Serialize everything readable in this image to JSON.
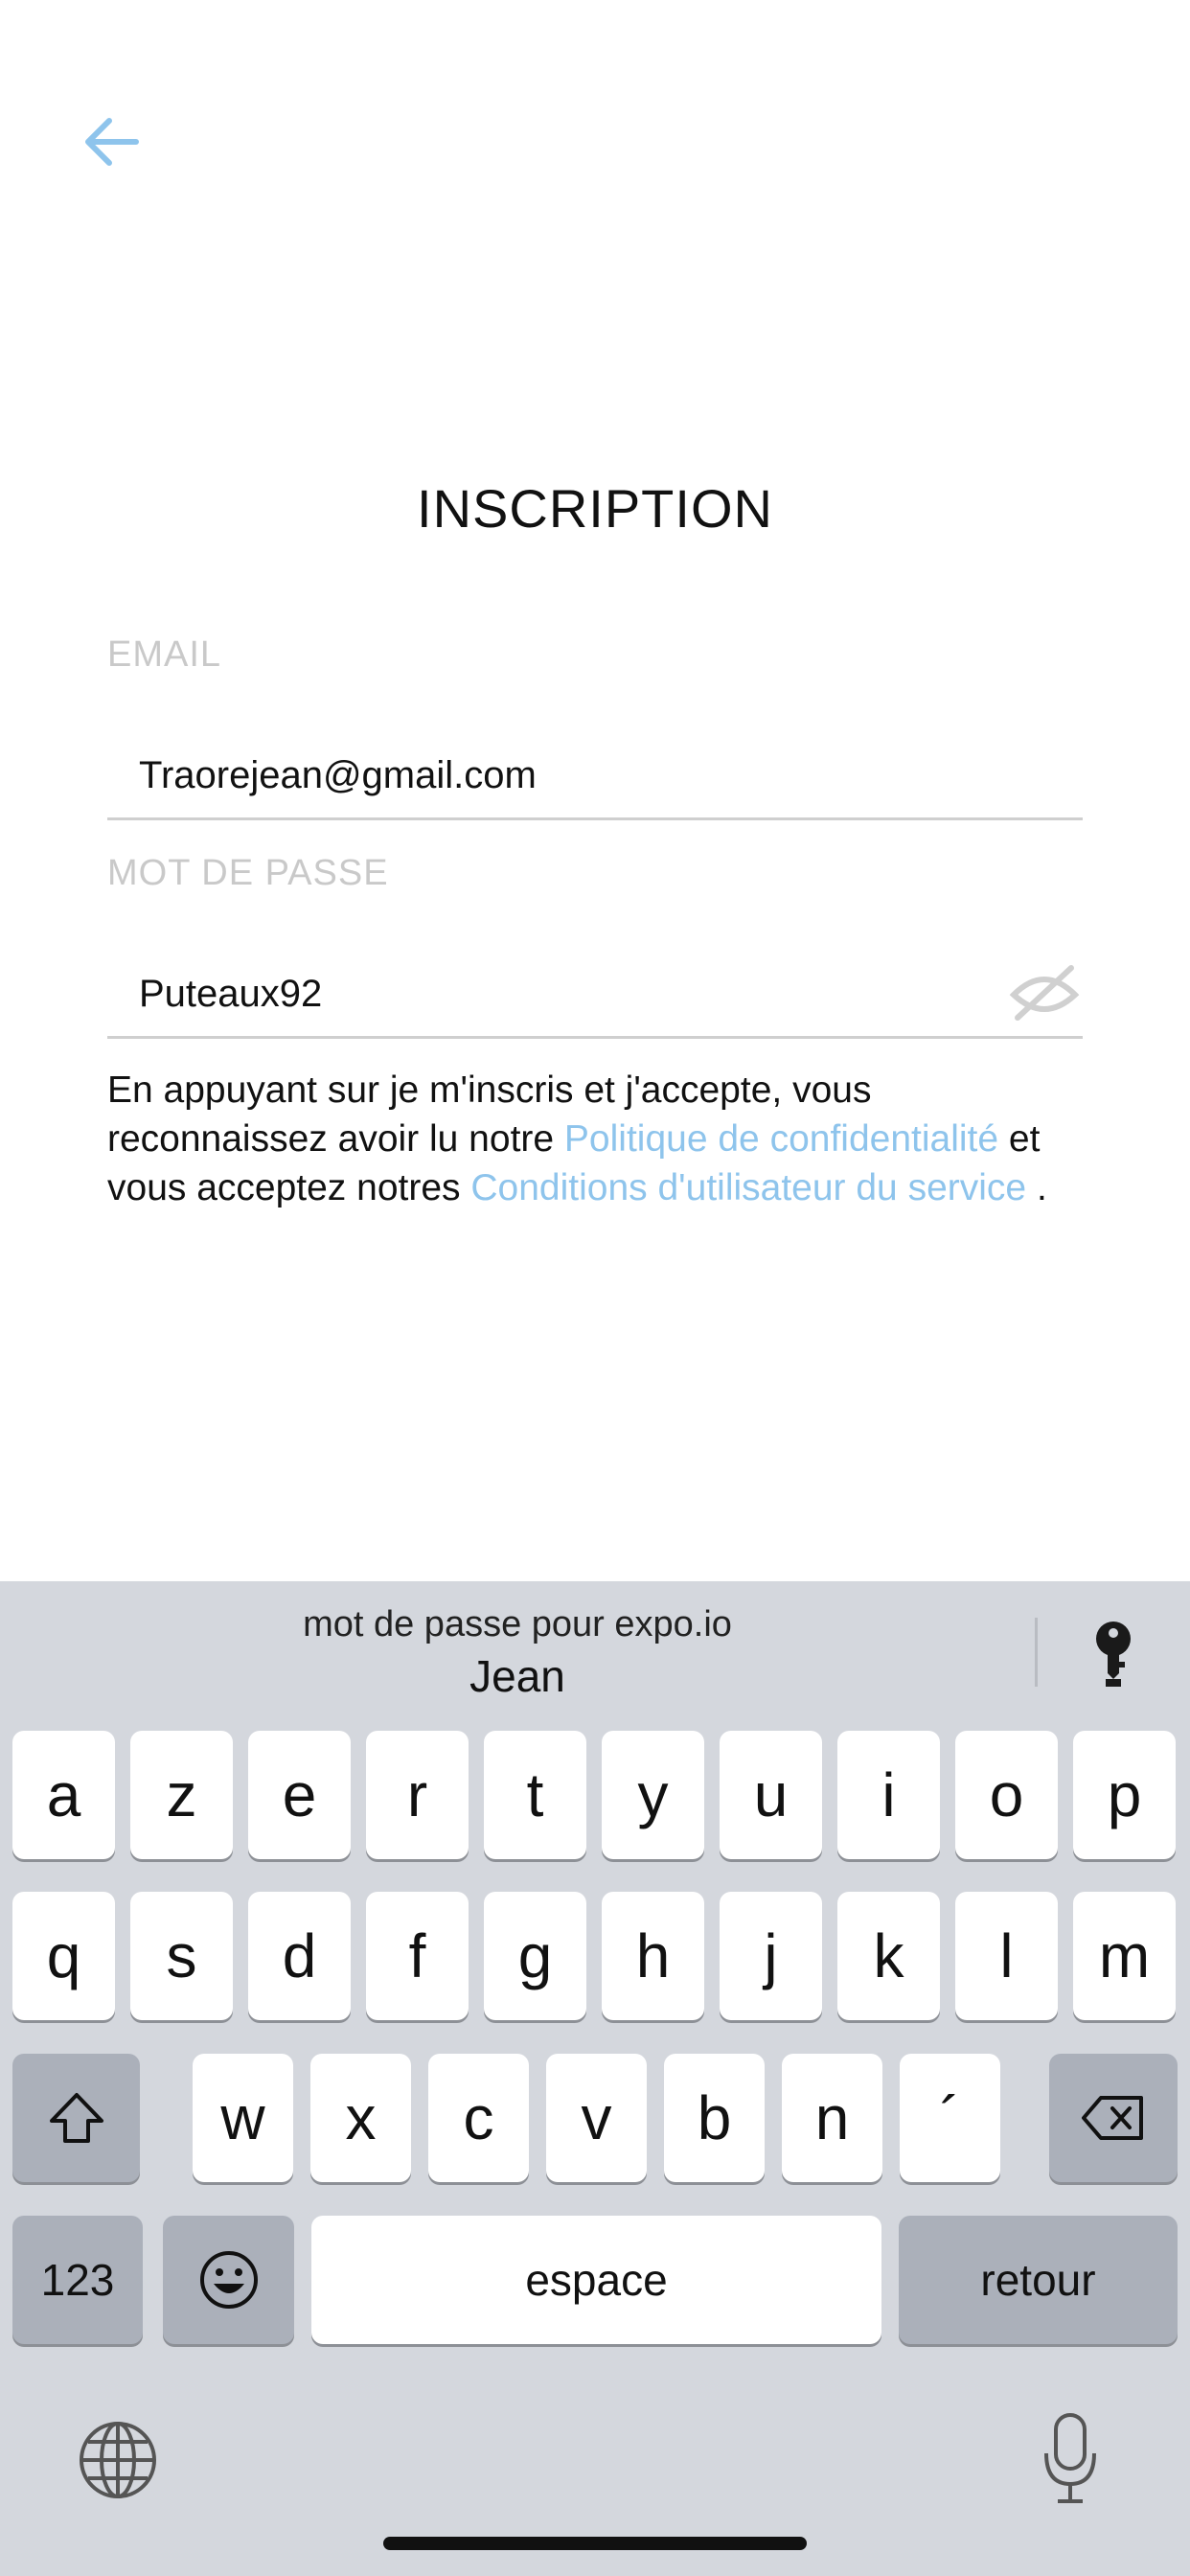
{
  "header": {
    "title": "INSCRIPTION"
  },
  "form": {
    "email_label": "EMAIL",
    "email_value": "Traorejean@gmail.com",
    "password_label": "MOT DE PASSE",
    "password_value": "Puteaux92"
  },
  "consent": {
    "text_1": "En appuyant sur je m'inscris et j'accepte, vous reconnaissez avoir lu notre ",
    "link_privacy": "Politique de confidentialité",
    "text_2": " et vous acceptez notres ",
    "link_terms": "Conditions d'utilisateur du service",
    "text_3": " ."
  },
  "keyboard": {
    "suggestion_caption": "mot de passe pour expo.io",
    "suggestion_value": "Jean",
    "row1": [
      "a",
      "z",
      "e",
      "r",
      "t",
      "y",
      "u",
      "i",
      "o",
      "p"
    ],
    "row2": [
      "q",
      "s",
      "d",
      "f",
      "g",
      "h",
      "j",
      "k",
      "l",
      "m"
    ],
    "row3": [
      "w",
      "x",
      "c",
      "v",
      "b",
      "n",
      "´"
    ],
    "numbers_label": "123",
    "space_label": "espace",
    "return_label": "retour"
  },
  "colors": {
    "accent": "#8ec4ec",
    "keyboard_bg": "#d4d7dd",
    "key_dark": "#abb0ba"
  }
}
